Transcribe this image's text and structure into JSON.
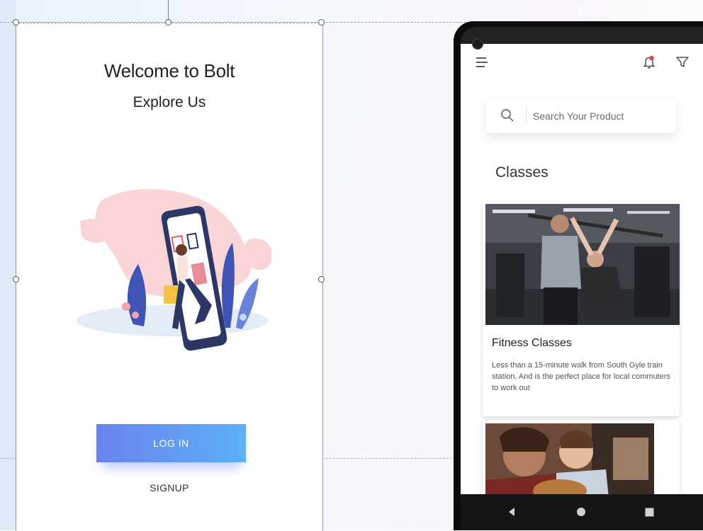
{
  "left_screen": {
    "title": "Welcome to Bolt",
    "subtitle": "Explore Us",
    "login_label": "LOG IN",
    "signup_label": "SIGNUP"
  },
  "phone": {
    "search": {
      "placeholder": "Search Your Product"
    },
    "section_title": "Classes",
    "cards": [
      {
        "title": "Fitness Classes",
        "description": "Less than a 15-minute walk from South Gyle train station, And is the perfect place for local commuters to work out"
      }
    ],
    "icons": [
      "menu-icon",
      "bell-icon",
      "filter-icon",
      "search-icon"
    ],
    "nav_icons": [
      "back-icon",
      "home-icon",
      "recents-icon"
    ]
  },
  "colors": {
    "login_gradient_start": "#6a83ec",
    "login_gradient_end": "#5cb0f8",
    "notification_dot": "#e24b4b"
  }
}
